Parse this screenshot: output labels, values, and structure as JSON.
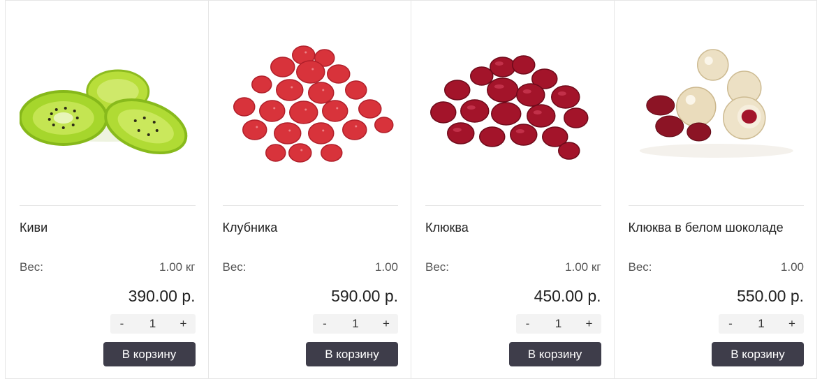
{
  "products": [
    {
      "name": "Киви",
      "weight_label": "Вес:",
      "weight_value": "1.00 кг",
      "price": "390.00 р.",
      "qty_minus": "-",
      "qty_value": "1",
      "qty_plus": "+",
      "cart_label": "В корзину",
      "image_icon": "kiwi-icon"
    },
    {
      "name": "Клубника",
      "weight_label": "Вес:",
      "weight_value": "1.00",
      "price": "590.00 р.",
      "qty_minus": "-",
      "qty_value": "1",
      "qty_plus": "+",
      "cart_label": "В корзину",
      "image_icon": "strawberry-icon"
    },
    {
      "name": "Клюква",
      "weight_label": "Вес:",
      "weight_value": "1.00 кг",
      "price": "450.00 р.",
      "qty_minus": "-",
      "qty_value": "1",
      "qty_plus": "+",
      "cart_label": "В корзину",
      "image_icon": "cranberry-icon"
    },
    {
      "name": "Клюква в белом шоколаде",
      "weight_label": "Вес:",
      "weight_value": "1.00",
      "price": "550.00 р.",
      "qty_minus": "-",
      "qty_value": "1",
      "qty_plus": "+",
      "cart_label": "В корзину",
      "image_icon": "chocolate-cranberry-icon"
    }
  ],
  "colors": {
    "button_bg": "#3e3d4a",
    "kiwi": "#a6d62c",
    "strawberry": "#d8333b",
    "cranberry": "#a3142a",
    "white_chocolate": "#ece0c4"
  }
}
